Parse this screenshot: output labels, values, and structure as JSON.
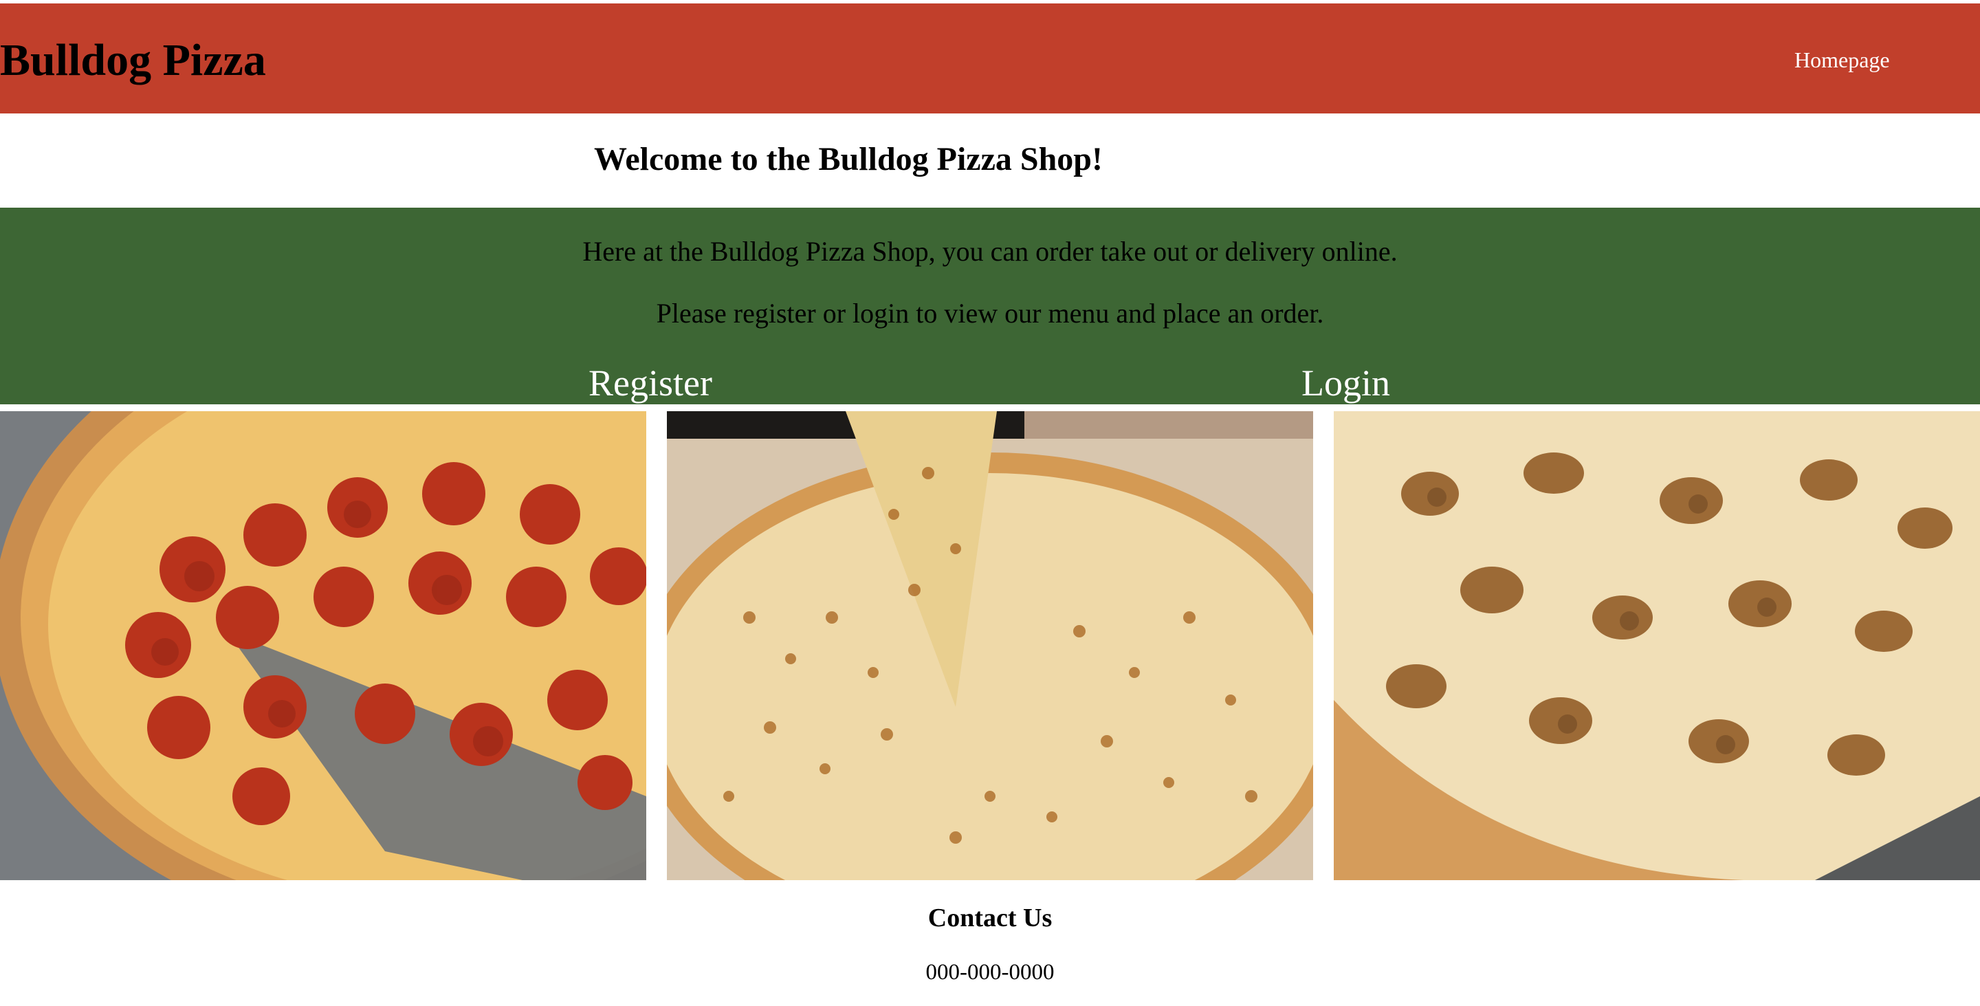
{
  "header": {
    "brand": "Bulldog Pizza",
    "nav_home": "Homepage",
    "background_color": "#c13f2b"
  },
  "welcome": {
    "heading": "Welcome to the Bulldog Pizza Shop!"
  },
  "intro": {
    "line1": "Here at the Bulldog Pizza Shop, you can order take out or delivery online.",
    "line2": "Please register or login to view our menu and place an order.",
    "register_label": "Register",
    "login_label": "Login",
    "background_color": "#3d6634"
  },
  "gallery": {
    "images": [
      {
        "subject": "pepperoni pizza"
      },
      {
        "subject": "cheese pizza"
      },
      {
        "subject": "sausage pizza"
      }
    ]
  },
  "contact": {
    "title": "Contact Us",
    "phone": "000-000-0000"
  }
}
